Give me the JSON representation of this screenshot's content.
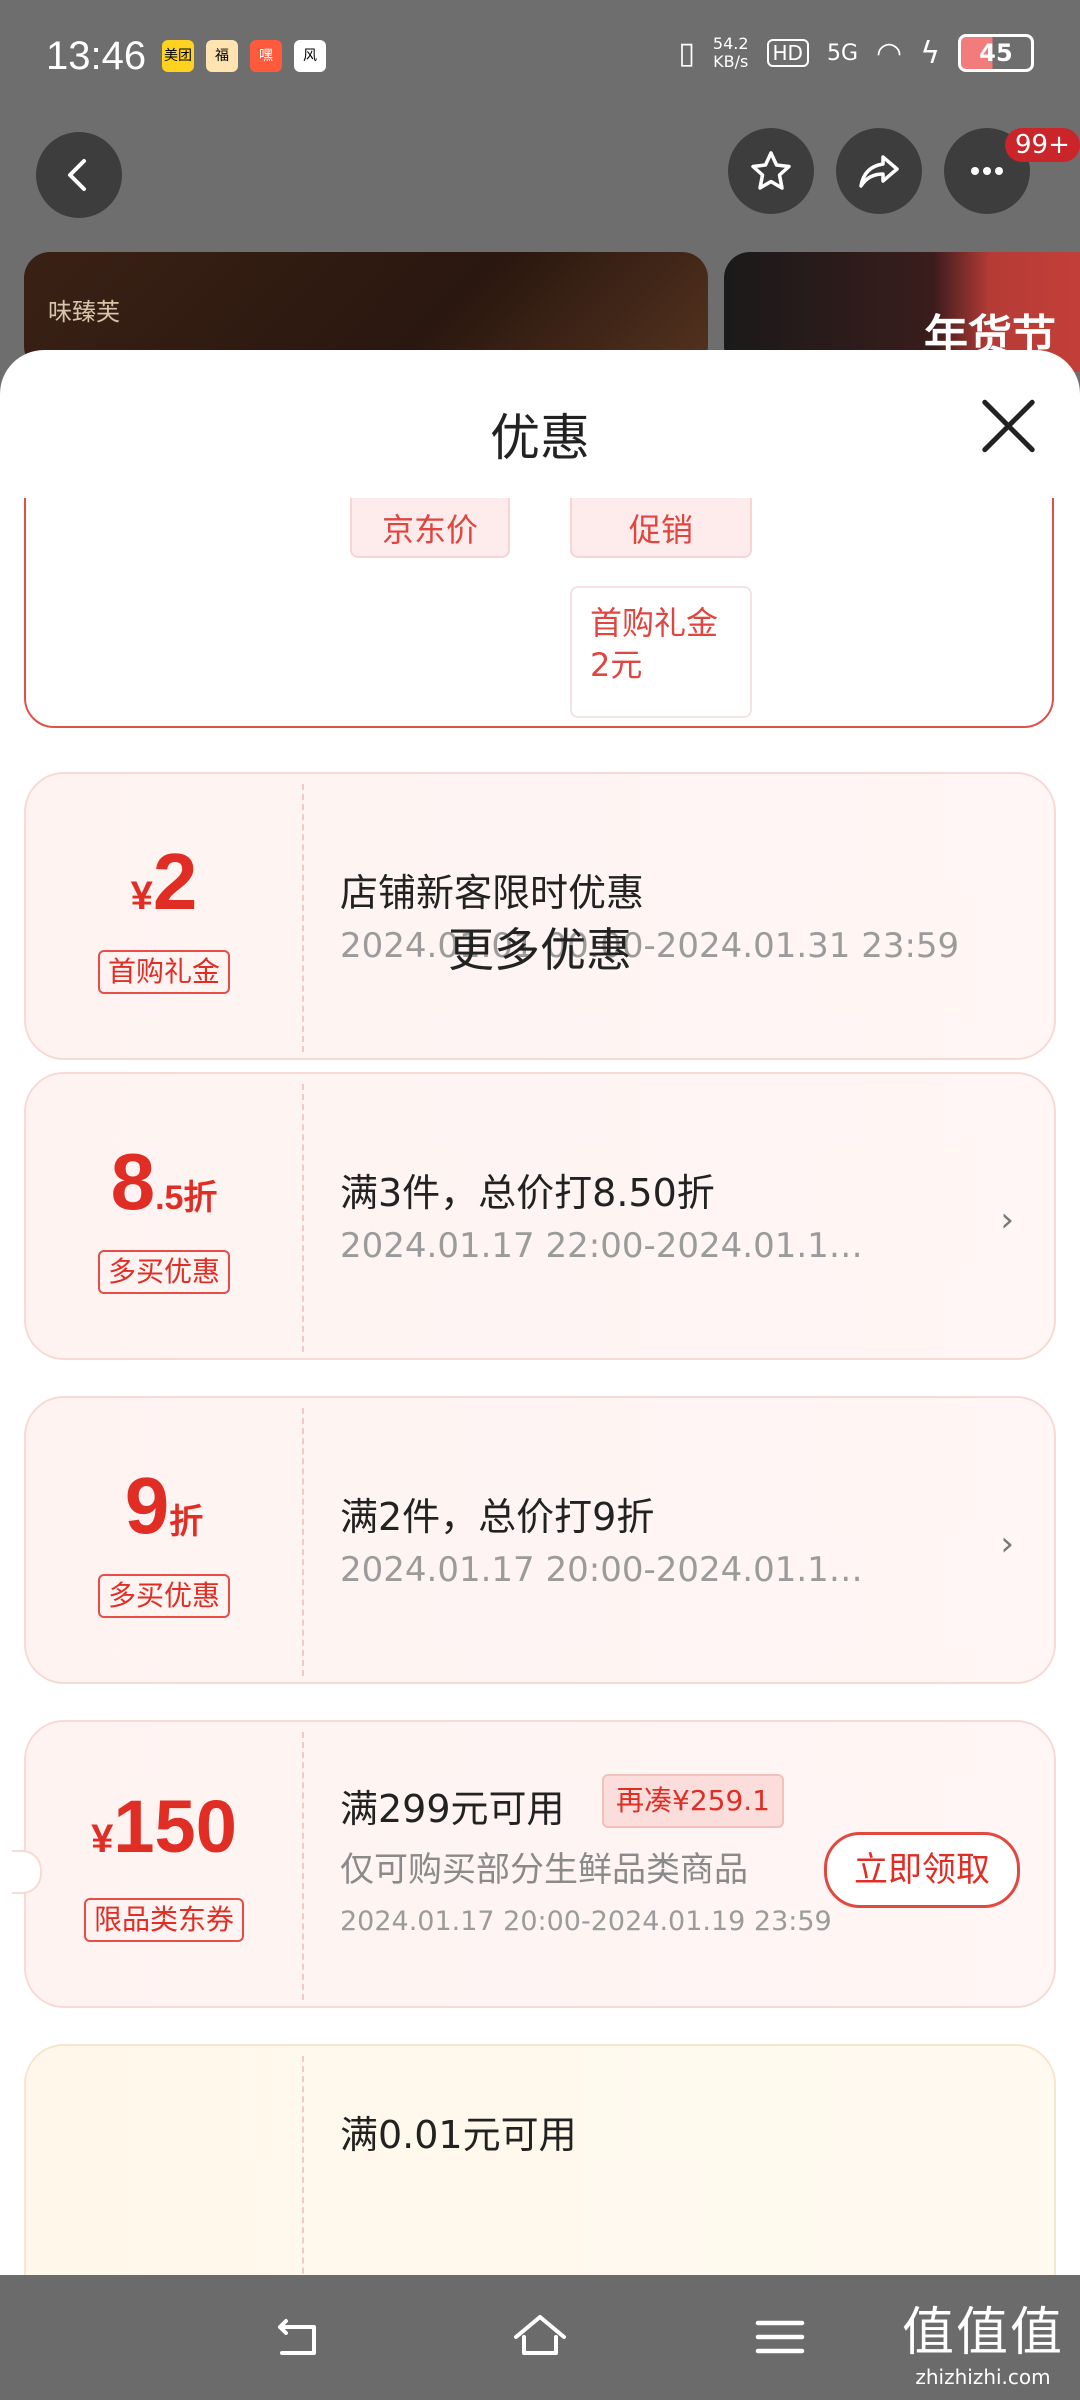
{
  "status_bar": {
    "time": "13:46",
    "app_icons": [
      "美团",
      "福",
      "嘿",
      "风"
    ],
    "net_speed": "54.2\nKB/s",
    "hd": "HD",
    "signal": "5G",
    "battery": "45"
  },
  "topbar": {
    "badge": "99+"
  },
  "hero": {
    "left_stamp": "味臻芙",
    "right_festival": "年货节"
  },
  "sheet": {
    "title": "优惠",
    "calc_chips": {
      "jd_price": "京东价",
      "promo": "促销",
      "gift": "首购礼金\n2元"
    },
    "first_coupon": {
      "yen": "¥",
      "amount": "2",
      "tag": "首购礼金",
      "title": "店铺新客限时优惠",
      "date": "2024.01.01 00:00-2024.01.31 23:59"
    },
    "more_title": "更多优惠",
    "offers": [
      {
        "amount_big": "8",
        "amount_small": ".5折",
        "tag": "多买优惠",
        "title": "满3件，总价打8.50折",
        "date": "2024.01.17 22:00-2024.01.1…",
        "chevron": "›"
      },
      {
        "amount_big": "9",
        "amount_small": "折",
        "tag": "多买优惠",
        "title": "满2件，总价打9折",
        "date": "2024.01.17 20:00-2024.01.1…",
        "chevron": "›"
      }
    ],
    "coupon": {
      "yen": "¥",
      "amount": "150",
      "tag": "限品类东券",
      "title": "满299元可用",
      "pill": "再凑¥259.1",
      "desc": "仅可购买部分生鲜品类商品",
      "date": "2024.01.17 20:00-2024.01.19 23:59",
      "button": "立即领取"
    },
    "partial_coupon": {
      "title": "满0.01元可用"
    }
  },
  "watermark": {
    "main": "值值值",
    "sub": "zhizhizhi.com"
  }
}
